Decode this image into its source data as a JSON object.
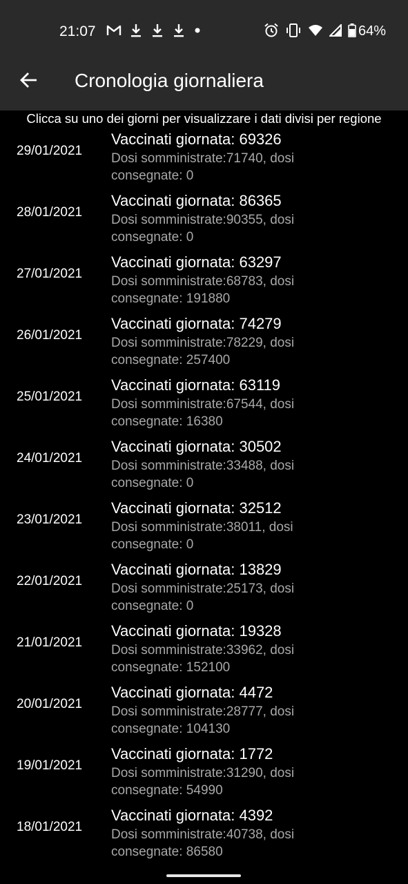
{
  "status_bar": {
    "time": "21:07",
    "battery_percent": "64%",
    "left_icons": [
      "gmail-icon",
      "download-icon",
      "download-icon",
      "download-icon",
      "dot-icon"
    ],
    "right_icons": [
      "alarm-icon",
      "vibrate-icon",
      "wifi-icon",
      "signal-icon",
      "battery-icon"
    ]
  },
  "app_bar": {
    "title": "Cronologia giornaliera",
    "back_icon": "arrow-back-icon"
  },
  "instruction": "Clicca su uno dei giorni per visualizzare i dati divisi per regione",
  "rows": [
    {
      "date": "29/01/2021",
      "title": "Vaccinati giornata: 69326",
      "sub": "Dosi somministrate:71740, dosi consegnate: 0"
    },
    {
      "date": "28/01/2021",
      "title": "Vaccinati giornata: 86365",
      "sub": "Dosi somministrate:90355, dosi consegnate: 0"
    },
    {
      "date": "27/01/2021",
      "title": "Vaccinati giornata: 63297",
      "sub": "Dosi somministrate:68783, dosi consegnate: 191880"
    },
    {
      "date": "26/01/2021",
      "title": "Vaccinati giornata: 74279",
      "sub": "Dosi somministrate:78229, dosi consegnate: 257400"
    },
    {
      "date": "25/01/2021",
      "title": "Vaccinati giornata: 63119",
      "sub": "Dosi somministrate:67544, dosi consegnate: 16380"
    },
    {
      "date": "24/01/2021",
      "title": "Vaccinati giornata: 30502",
      "sub": "Dosi somministrate:33488, dosi consegnate: 0"
    },
    {
      "date": "23/01/2021",
      "title": "Vaccinati giornata: 32512",
      "sub": "Dosi somministrate:38011, dosi consegnate: 0"
    },
    {
      "date": "22/01/2021",
      "title": "Vaccinati giornata: 13829",
      "sub": "Dosi somministrate:25173, dosi consegnate: 0"
    },
    {
      "date": "21/01/2021",
      "title": "Vaccinati giornata: 19328",
      "sub": "Dosi somministrate:33962, dosi consegnate: 152100"
    },
    {
      "date": "20/01/2021",
      "title": "Vaccinati giornata: 4472",
      "sub": "Dosi somministrate:28777, dosi consegnate: 104130"
    },
    {
      "date": "19/01/2021",
      "title": "Vaccinati giornata: 1772",
      "sub": "Dosi somministrate:31290, dosi consegnate: 54990"
    },
    {
      "date": "18/01/2021",
      "title": "Vaccinati giornata: 4392",
      "sub": "Dosi somministrate:40738, dosi consegnate: 86580"
    }
  ],
  "colors": {
    "background": "#000000",
    "app_bar": "#2a2a2a",
    "primary_text": "#ffffff",
    "secondary_text": "#a8a8a8"
  }
}
